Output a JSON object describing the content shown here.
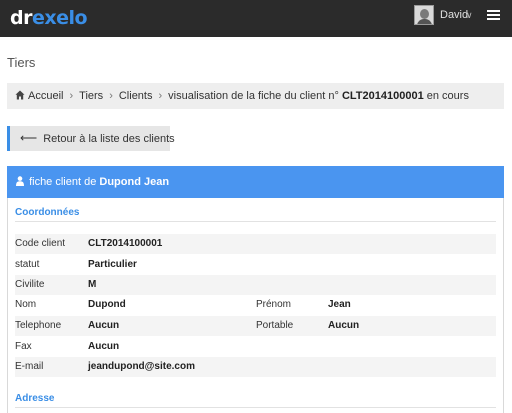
{
  "header": {
    "logo_part1": "dr",
    "logo_part2": "exel",
    "logo_part3": "o",
    "username": "David",
    "colors": {
      "bar": "#2b2b2b",
      "accent": "#3a8ee6"
    }
  },
  "page_title": "Tiers",
  "breadcrumb": {
    "home": "Accueil",
    "items": [
      "Tiers",
      "Clients"
    ],
    "current_prefix": "visualisation de la fiche du client n°",
    "client_code": "CLT2014100001",
    "current_suffix": "en cours"
  },
  "back_button": {
    "label": "Retour à la liste des clients"
  },
  "card": {
    "title_prefix": "fiche client de",
    "client_name": "Dupond Jean",
    "header_color": "#4a95f0"
  },
  "sections": {
    "coordonnees": "Coordonnées",
    "adresse": "Adresse"
  },
  "fields": {
    "code_client": {
      "label": "Code client",
      "value": "CLT2014100001"
    },
    "statut": {
      "label": "statut",
      "value": "Particulier"
    },
    "civilite": {
      "label": "Civilite",
      "value": "M"
    },
    "nom": {
      "label": "Nom",
      "value": "Dupond"
    },
    "prenom": {
      "label": "Prénom",
      "value": "Jean"
    },
    "telephone": {
      "label": "Telephone",
      "value": "Aucun"
    },
    "portable": {
      "label": "Portable",
      "value": "Aucun"
    },
    "fax": {
      "label": "Fax",
      "value": "Aucun"
    },
    "email": {
      "label": "E-mail",
      "value": "jeandupond@site.com"
    }
  }
}
